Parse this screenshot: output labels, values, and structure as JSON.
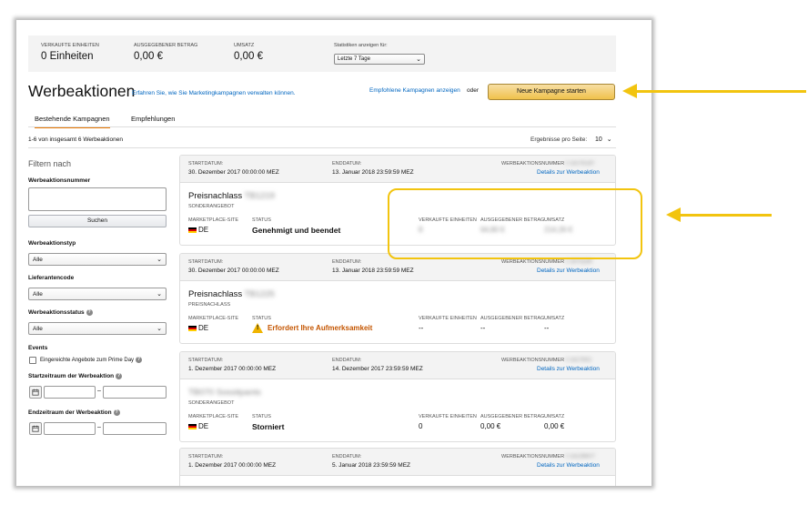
{
  "stats": {
    "units_label": "VERKAUFTE EINHEITEN",
    "units_value": "0 Einheiten",
    "spend_label": "AUSGEGEBENER BETRAG",
    "spend_value": "0,00 €",
    "revenue_label": "UMSATZ",
    "revenue_value": "0,00 €",
    "period_label": "Statistiken anzeigen für:",
    "period_value": "Letzte 7 Tage"
  },
  "header": {
    "title": "Werbeaktionen",
    "learn_link": "Erfahren Sie, wie Sie Marketingkampagnen verwalten können.",
    "recommended_link": "Empfohlene Kampagnen anzeigen",
    "or_text": "oder",
    "new_campaign_button": "Neue Kampagne starten"
  },
  "tabs": [
    {
      "label": "Bestehende Kampagnen",
      "active": true
    },
    {
      "label": "Empfehlungen",
      "active": false
    }
  ],
  "results": {
    "summary": "1-6 von insgesamt 6 Werbeaktionen",
    "per_page_label": "Ergebnisse pro Seite:",
    "per_page_value": "10"
  },
  "filters": {
    "title": "Filtern nach",
    "promo_number_label": "Werbeaktionsnummer",
    "search_button": "Suchen",
    "type_label": "Werbeaktionstyp",
    "type_value": "Alle",
    "supplier_label": "Lieferantencode",
    "supplier_value": "Alle",
    "status_label": "Werbeaktionsstatus",
    "status_value": "Alle",
    "events_label": "Events",
    "prime_day_label": "Eingereichte Angebote zum Prime Day",
    "start_range_label": "Startzeitraum der Werbeaktion",
    "end_range_label": "Endzeitraum der Werbeaktion",
    "range_separator": "–"
  },
  "card_labels": {
    "start": "STARTDATUM:",
    "end": "ENDDATUM:",
    "number": "WERBEAKTIONSNUMMER",
    "details": "Details zur Werbeaktion",
    "marketplace": "MARKETPLACE-SITE",
    "status": "STATUS",
    "units": "VERKAUFTE EINHEITEN",
    "spend": "AUSGEGEBENER BETRAG",
    "revenue": "UMSATZ"
  },
  "campaigns": [
    {
      "start": "30. Dezember 2017 00:00:00 MEZ",
      "end": "13. Januar 2018 23:59:59 MEZ",
      "number": "# 1A1Y5U2F",
      "title": "Preisnachlass",
      "title_id": "TB1219",
      "type": "SONDERANGEBOT",
      "marketplace": "DE",
      "status": "Genehmigt und beendet",
      "units": "8",
      "spend": "64,80 €",
      "revenue": "214,26 €"
    },
    {
      "start": "30. Dezember 2017 00:00:00 MEZ",
      "end": "13. Januar 2018 23:59:59 MEZ",
      "number": "# 1B7GQ4K",
      "title": "Preisnachlass",
      "title_id": "TB1225",
      "type": "PREISNACHLASS",
      "marketplace": "DE",
      "status": "Erfordert Ihre Aufmerksamkeit",
      "units": "--",
      "spend": "--",
      "revenue": "--"
    },
    {
      "start": "1. Dezember 2017 00:00:00 MEZ",
      "end": "14. Dezember 2017 23:59:59 MEZ",
      "number": "# 1A17DK3",
      "title": "TB070 Sossitpants",
      "type": "SONDERANGEBOT",
      "marketplace": "DE",
      "status": "Storniert",
      "units": "0",
      "spend": "0,00 €",
      "revenue": "0,00 €"
    },
    {
      "start": "1. Dezember 2017 00:00:00 MEZ",
      "end": "5. Januar 2018 23:59:59 MEZ",
      "number": "# 1A1Z8MV7",
      "details": "Details zur Werbeaktion"
    }
  ],
  "colors": {
    "accent_orange": "#e77600",
    "link_blue": "#0066c0",
    "button_yellow": "#f0c14b",
    "annotation_yellow": "#f2c40f",
    "warning_text": "#c45500"
  }
}
